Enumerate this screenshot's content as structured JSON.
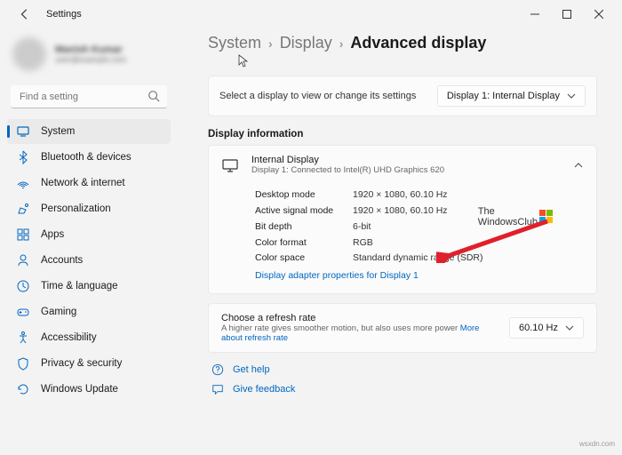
{
  "window": {
    "title": "Settings"
  },
  "user": {
    "name": "Manish Kumar",
    "email": "user@example.com"
  },
  "search": {
    "placeholder": "Find a setting"
  },
  "nav": [
    {
      "label": "System"
    },
    {
      "label": "Bluetooth & devices"
    },
    {
      "label": "Network & internet"
    },
    {
      "label": "Personalization"
    },
    {
      "label": "Apps"
    },
    {
      "label": "Accounts"
    },
    {
      "label": "Time & language"
    },
    {
      "label": "Gaming"
    },
    {
      "label": "Accessibility"
    },
    {
      "label": "Privacy & security"
    },
    {
      "label": "Windows Update"
    }
  ],
  "breadcrumb": {
    "a": "System",
    "b": "Display",
    "c": "Advanced display"
  },
  "selector": {
    "desc": "Select a display to view or change its settings",
    "value": "Display 1: Internal Display"
  },
  "section": {
    "title": "Display information"
  },
  "info": {
    "name": "Internal Display",
    "sub": "Display 1: Connected to Intel(R) UHD Graphics 620",
    "rows": [
      {
        "k": "Desktop mode",
        "v": "1920 × 1080, 60.10 Hz"
      },
      {
        "k": "Active signal mode",
        "v": "1920 × 1080, 60.10 Hz"
      },
      {
        "k": "Bit depth",
        "v": "6-bit"
      },
      {
        "k": "Color format",
        "v": "RGB"
      },
      {
        "k": "Color space",
        "v": "Standard dynamic range (SDR)"
      }
    ],
    "adapter_link": "Display adapter properties for Display 1"
  },
  "refresh": {
    "title": "Choose a refresh rate",
    "sub": "A higher rate gives smoother motion, but also uses more power",
    "more": "More about refresh rate",
    "value": "60.10 Hz"
  },
  "footer": {
    "help": "Get help",
    "feedback": "Give feedback"
  },
  "watermark": {
    "line1": "The",
    "line2": "WindowsClub"
  },
  "credit": "wsxdn.com"
}
